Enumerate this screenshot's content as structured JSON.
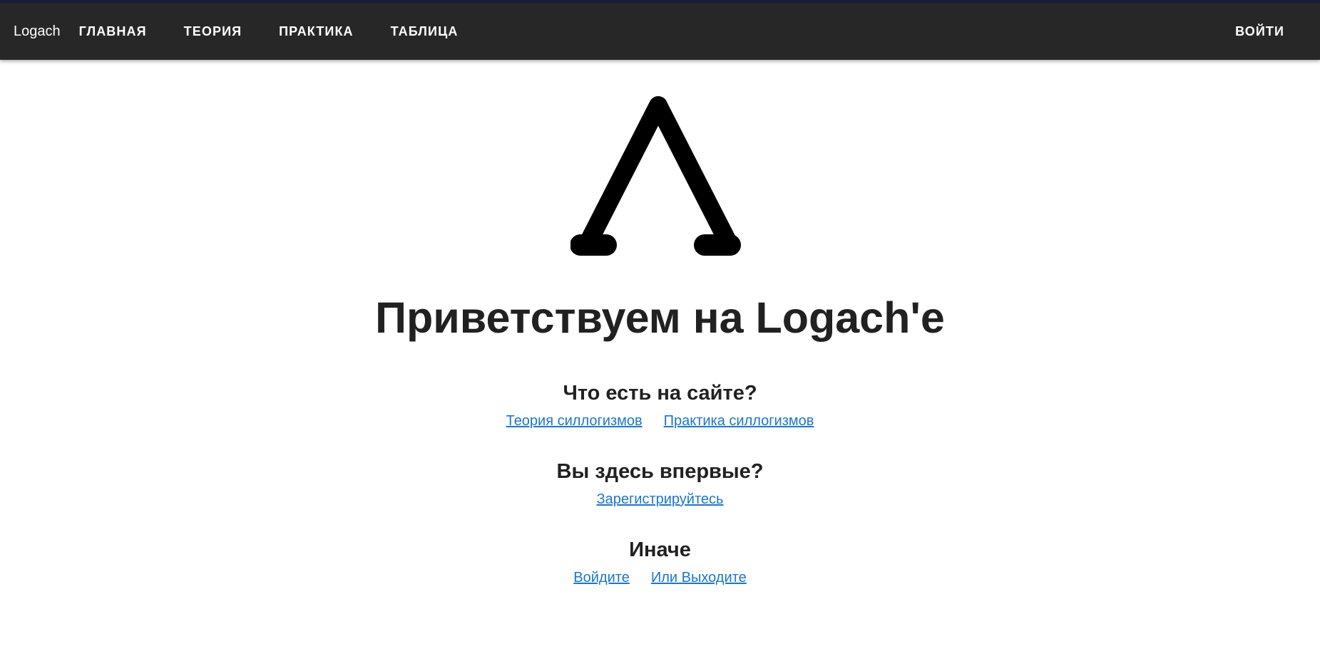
{
  "app": {
    "brand": "Logach"
  },
  "nav": {
    "items": [
      {
        "label": "ГЛАВНАЯ"
      },
      {
        "label": "ТЕОРИЯ"
      },
      {
        "label": "ПРАКТИКА"
      },
      {
        "label": "ТАБЛИЦА"
      }
    ],
    "login_label": "ВОЙТИ"
  },
  "colors": {
    "appbar": "#272727",
    "link": "#1976d2",
    "text": "#212121"
  },
  "logo": {
    "icon": "lambda-icon"
  },
  "hero": {
    "title": "Приветствуем на Logach'е"
  },
  "sections": [
    {
      "title": "Что есть на сайте?",
      "links": [
        "Теория силлогизмов",
        "Практика силлогизмов"
      ]
    },
    {
      "title": "Вы здесь впервые?",
      "links": [
        "Зарегистрируйтесь"
      ]
    },
    {
      "title": "Иначе",
      "links": [
        "Войдите",
        "Или Выходите"
      ]
    }
  ]
}
